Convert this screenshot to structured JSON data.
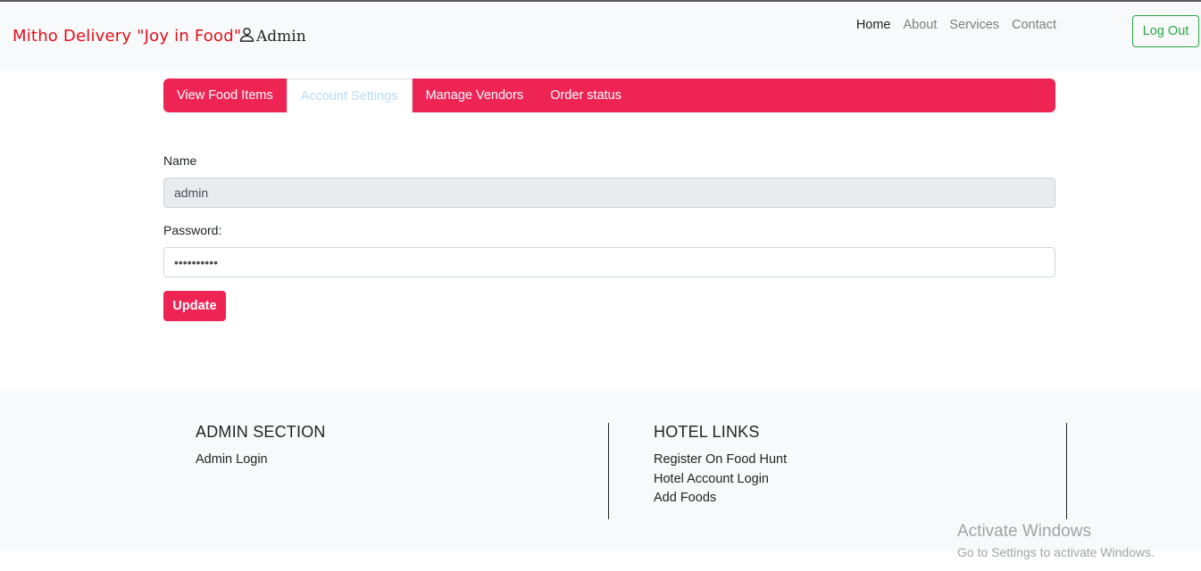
{
  "navbar": {
    "brand": "Mitho Delivery \"Joy in Food\"",
    "user_label": "Admin",
    "links": [
      "Home",
      "About",
      "Services",
      "Contact"
    ],
    "logout_label": "Log Out"
  },
  "tabs": [
    {
      "label": "View Food Items",
      "active": false
    },
    {
      "label": "Account Settings",
      "active": true
    },
    {
      "label": "Manage Vendors",
      "active": false
    },
    {
      "label": "Order status",
      "active": false
    }
  ],
  "form": {
    "name_label": "Name",
    "name_value": "admin",
    "password_label": "Password:",
    "password_value": "••••••••••",
    "update_label": "Update"
  },
  "footer": {
    "admin_section": {
      "heading": "ADMIN SECTION",
      "links": [
        "Admin Login"
      ]
    },
    "hotel_links": {
      "heading": "HOTEL LINKS",
      "links": [
        "Register On Food Hunt",
        "Hotel Account Login",
        "Add Foods"
      ]
    }
  },
  "watermark": {
    "line1": "Activate Windows",
    "line2": "Go to Settings to activate Windows."
  },
  "colors": {
    "accent": "#ee2455",
    "brand": "#e0101c",
    "success": "#28a745"
  }
}
